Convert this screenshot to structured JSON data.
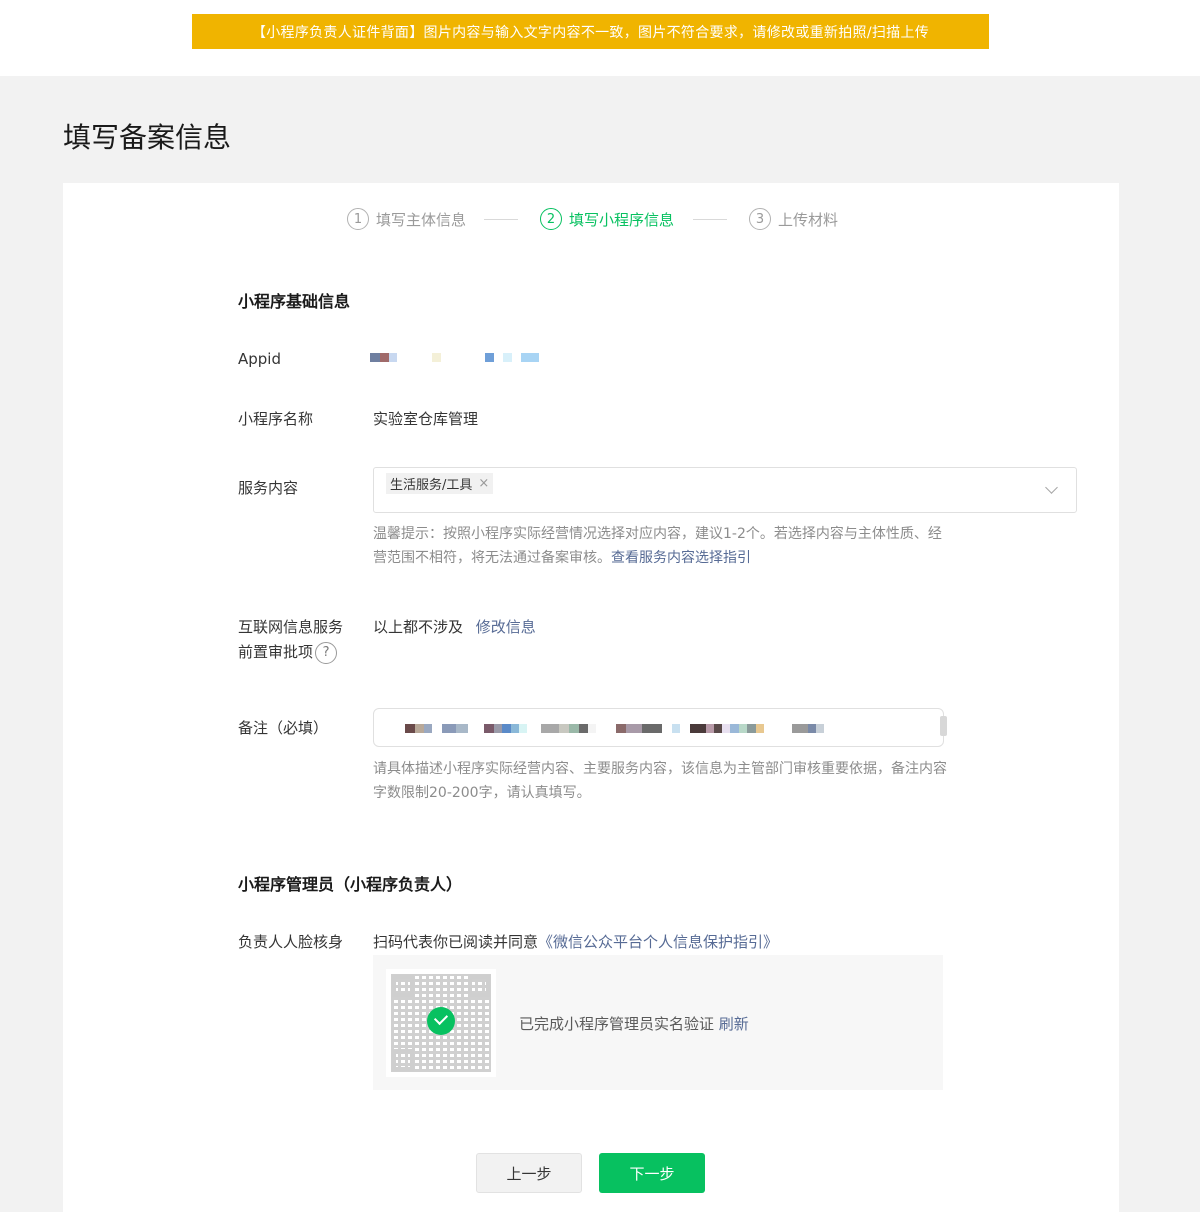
{
  "alert": {
    "text": "【小程序负责人证件背面】图片内容与输入文字内容不一致，图片不符合要求，请修改或重新拍照/扫描上传"
  },
  "page": {
    "title": "填写备案信息"
  },
  "steps": [
    {
      "num": "1",
      "label": "填写主体信息",
      "state": "done"
    },
    {
      "num": "2",
      "label": "填写小程序信息",
      "state": "active"
    },
    {
      "num": "3",
      "label": "上传材料",
      "state": "pending"
    }
  ],
  "basic": {
    "section_title": "小程序基础信息",
    "appid_label": "Appid",
    "name_label": "小程序名称",
    "name_value": "实验室仓库管理",
    "service_label": "服务内容",
    "service_tag": "生活服务/工具",
    "service_tag_remove": "×",
    "service_hint": "温馨提示：按照小程序实际经营情况选择对应内容，建议1-2个。若选择内容与主体性质、经营范围不相符，将无法通过备案审核。",
    "service_hint_link": "查看服务内容选择指引",
    "internet_label_line1": "互联网信息服务",
    "internet_label_line2": "前置审批项",
    "help_icon": "?",
    "internet_value": "以上都不涉及",
    "internet_link": "修改信息",
    "remark_label": "备注（必填）",
    "remark_hint": "请具体描述小程序实际经营内容、主要服务内容，该信息为主管部门审核重要依据，备注内容字数限制20-200字，请认真填写。"
  },
  "admin": {
    "section_title": "小程序管理员（小程序负责人）",
    "face_label": "负责人人脸核身",
    "agree_text": "扫码代表你已阅读并同意",
    "agree_link": "《微信公众平台个人信息保护指引》",
    "verified_text": "已完成小程序管理员实名验证",
    "refresh_link": "刷新"
  },
  "buttons": {
    "prev": "上一步",
    "next": "下一步"
  },
  "colors": {
    "alert": "#f0b400",
    "primary": "#07c160",
    "link": "#576b95",
    "background": "#f2f2f2"
  },
  "icons": [
    "help-icon",
    "chevron-down-icon",
    "close-icon",
    "check-icon",
    "qr-code-icon"
  ]
}
